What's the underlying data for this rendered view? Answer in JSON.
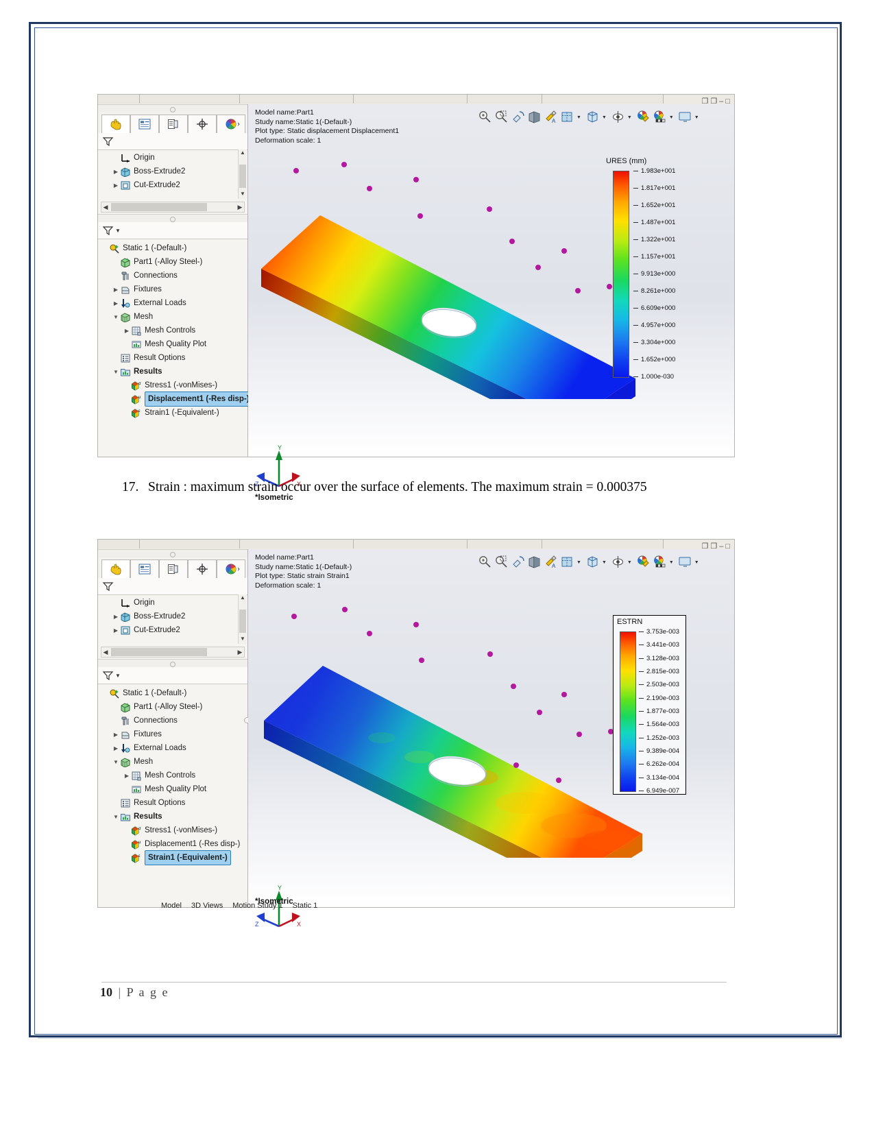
{
  "document": {
    "footer_page_number": "10",
    "footer_separator": "|",
    "footer_label": "P a g e",
    "paragraph_number": "17.",
    "paragraph_text": "Strain :   maximum strain occur over the surface of elements. The maximum strain = 0.000375"
  },
  "figure1": {
    "window_title_meta": {
      "model_name": "Model name:Part1",
      "study_name": "Study name:Static 1(-Default-)",
      "plot_type": "Plot type: Static displacement Displacement1",
      "deformation_scale": "Deformation scale: 1"
    },
    "view_label": "*Isometric",
    "feature_tree": [
      {
        "label": "Origin",
        "icon": "origin-icon",
        "indent": 1,
        "arrow": ""
      },
      {
        "label": "Boss-Extrude2",
        "icon": "extrude-icon",
        "indent": 1,
        "arrow": "collapsed"
      },
      {
        "label": "Cut-Extrude2",
        "icon": "cut-extrude-icon",
        "indent": 1,
        "arrow": "collapsed"
      }
    ],
    "study_tree": [
      {
        "label": "Static 1 (-Default-)",
        "icon": "study-icon",
        "indent": 0,
        "arrow": ""
      },
      {
        "label": "Part1 (-Alloy Steel-)",
        "icon": "solid-body-icon",
        "indent": 1,
        "arrow": ""
      },
      {
        "label": "Connections",
        "icon": "connections-icon",
        "indent": 1,
        "arrow": ""
      },
      {
        "label": "Fixtures",
        "icon": "fixtures-icon",
        "indent": 1,
        "arrow": "collapsed"
      },
      {
        "label": "External Loads",
        "icon": "external-loads-icon",
        "indent": 1,
        "arrow": "collapsed"
      },
      {
        "label": "Mesh",
        "icon": "mesh-icon",
        "indent": 1,
        "arrow": "expanded"
      },
      {
        "label": "Mesh Controls",
        "icon": "mesh-controls-icon",
        "indent": 2,
        "arrow": "collapsed"
      },
      {
        "label": "Mesh Quality Plot",
        "icon": "mesh-quality-plot-icon",
        "indent": 2,
        "arrow": ""
      },
      {
        "label": "Result Options",
        "icon": "result-options-icon",
        "indent": 1,
        "arrow": ""
      },
      {
        "label": "Results",
        "icon": "results-folder-icon",
        "indent": 1,
        "arrow": "expanded",
        "bold": true
      },
      {
        "label": "Stress1 (-vonMises-)",
        "icon": "stress-plot-icon",
        "indent": 2,
        "arrow": ""
      },
      {
        "label": "Displacement1 (-Res disp-)",
        "icon": "displacement-plot-icon",
        "indent": 2,
        "arrow": "",
        "selected": true
      },
      {
        "label": "Strain1 (-Equivalent-)",
        "icon": "strain-plot-icon",
        "indent": 2,
        "arrow": ""
      }
    ],
    "tabs": [
      "hand-tool-tab",
      "feature-manager-tab",
      "property-manager-tab",
      "configuration-manager-tab",
      "display-manager-tab"
    ],
    "toolbar_icons": [
      "zoom-to-area-icon",
      "zoom-to-fit-icon",
      "rotate-view-icon",
      "section-view-icon",
      "appearance-icon",
      "view-orientation-icon",
      "display-style-icon",
      "hide-show-icon",
      "apply-scene-icon",
      "view-settings-icon",
      "viewport-icon"
    ],
    "legend": {
      "title": "URES (mm)",
      "boxed": false,
      "ticks": [
        "1.983e+001",
        "1.817e+001",
        "1.652e+001",
        "1.487e+001",
        "1.322e+001",
        "1.157e+001",
        "9.913e+000",
        "8.261e+000",
        "6.609e+000",
        "4.957e+000",
        "3.304e+000",
        "1.652e+000",
        "1.000e-030"
      ]
    }
  },
  "figure2": {
    "window_title_meta": {
      "model_name": "Model name:Part1",
      "study_name": "Study name:Static 1(-Default-)",
      "plot_type": "Plot type: Static strain Strain1",
      "deformation_scale": "Deformation scale: 1"
    },
    "view_label": "*Isometric",
    "feature_tree": [
      {
        "label": "Origin",
        "icon": "origin-icon",
        "indent": 1,
        "arrow": ""
      },
      {
        "label": "Boss-Extrude2",
        "icon": "extrude-icon",
        "indent": 1,
        "arrow": "collapsed"
      },
      {
        "label": "Cut-Extrude2",
        "icon": "cut-extrude-icon",
        "indent": 1,
        "arrow": "collapsed"
      }
    ],
    "study_tree": [
      {
        "label": "Static 1 (-Default-)",
        "icon": "study-icon",
        "indent": 0,
        "arrow": ""
      },
      {
        "label": "Part1 (-Alloy Steel-)",
        "icon": "solid-body-icon",
        "indent": 1,
        "arrow": ""
      },
      {
        "label": "Connections",
        "icon": "connections-icon",
        "indent": 1,
        "arrow": ""
      },
      {
        "label": "Fixtures",
        "icon": "fixtures-icon",
        "indent": 1,
        "arrow": "collapsed"
      },
      {
        "label": "External Loads",
        "icon": "external-loads-icon",
        "indent": 1,
        "arrow": "collapsed"
      },
      {
        "label": "Mesh",
        "icon": "mesh-icon",
        "indent": 1,
        "arrow": "expanded"
      },
      {
        "label": "Mesh Controls",
        "icon": "mesh-controls-icon",
        "indent": 2,
        "arrow": "collapsed"
      },
      {
        "label": "Mesh Quality Plot",
        "icon": "mesh-quality-plot-icon",
        "indent": 2,
        "arrow": ""
      },
      {
        "label": "Result Options",
        "icon": "result-options-icon",
        "indent": 1,
        "arrow": ""
      },
      {
        "label": "Results",
        "icon": "results-folder-icon",
        "indent": 1,
        "arrow": "expanded",
        "bold": true
      },
      {
        "label": "Stress1 (-vonMises-)",
        "icon": "stress-plot-icon",
        "indent": 2,
        "arrow": ""
      },
      {
        "label": "Displacement1 (-Res disp-)",
        "icon": "displacement-plot-icon",
        "indent": 2,
        "arrow": ""
      },
      {
        "label": "Strain1 (-Equivalent-)",
        "icon": "strain-plot-icon",
        "indent": 2,
        "arrow": "",
        "selected": true
      }
    ],
    "bottom_tabs": [
      "Model",
      "3D Views",
      "Motion Study 1",
      "Static 1"
    ],
    "legend": {
      "title": "ESTRN",
      "boxed": true,
      "ticks": [
        "3.753e-003",
        "3.441e-003",
        "3.128e-003",
        "2.815e-003",
        "2.503e-003",
        "2.190e-003",
        "1.877e-003",
        "1.564e-003",
        "1.252e-003",
        "9.389e-004",
        "6.262e-004",
        "3.134e-004",
        "6.949e-007"
      ]
    }
  },
  "chart_data": [
    {
      "type": "heatmap",
      "title": "URES (mm)",
      "subtitle": "Static displacement Displacement1 — Part1 — Static 1 (-Default-)",
      "legend_position": "right",
      "colormap": "rainbow (blue=min, red=max)",
      "zlabel": "URES (mm)",
      "tick_labels": [
        "1.983e+001",
        "1.817e+001",
        "1.652e+001",
        "1.487e+001",
        "1.322e+001",
        "1.157e+001",
        "9.913e+000",
        "8.261e+000",
        "6.609e+000",
        "4.957e+000",
        "3.304e+000",
        "1.652e+000",
        "1.000e-030"
      ],
      "values": [
        19.83,
        18.17,
        16.52,
        14.87,
        13.22,
        11.57,
        9.913,
        8.261,
        6.609,
        4.957,
        3.304,
        1.652,
        1e-30
      ],
      "zlim": [
        1e-30,
        19.83
      ]
    },
    {
      "type": "heatmap",
      "title": "ESTRN",
      "subtitle": "Static strain Strain1 — Part1 — Static 1 (-Default-)",
      "legend_position": "right",
      "colormap": "rainbow (blue=min, red=max)",
      "zlabel": "ESTRN",
      "tick_labels": [
        "3.753e-003",
        "3.441e-003",
        "3.128e-003",
        "2.815e-003",
        "2.503e-003",
        "2.190e-003",
        "1.877e-003",
        "1.564e-003",
        "1.252e-003",
        "9.389e-004",
        "6.262e-004",
        "3.134e-004",
        "6.949e-007"
      ],
      "values": [
        0.003753,
        0.003441,
        0.003128,
        0.002815,
        0.002503,
        0.00219,
        0.001877,
        0.001564,
        0.001252,
        0.0009389,
        0.0006262,
        0.0003134,
        6.949e-07
      ],
      "zlim": [
        6.949e-07,
        0.003753
      ]
    }
  ]
}
